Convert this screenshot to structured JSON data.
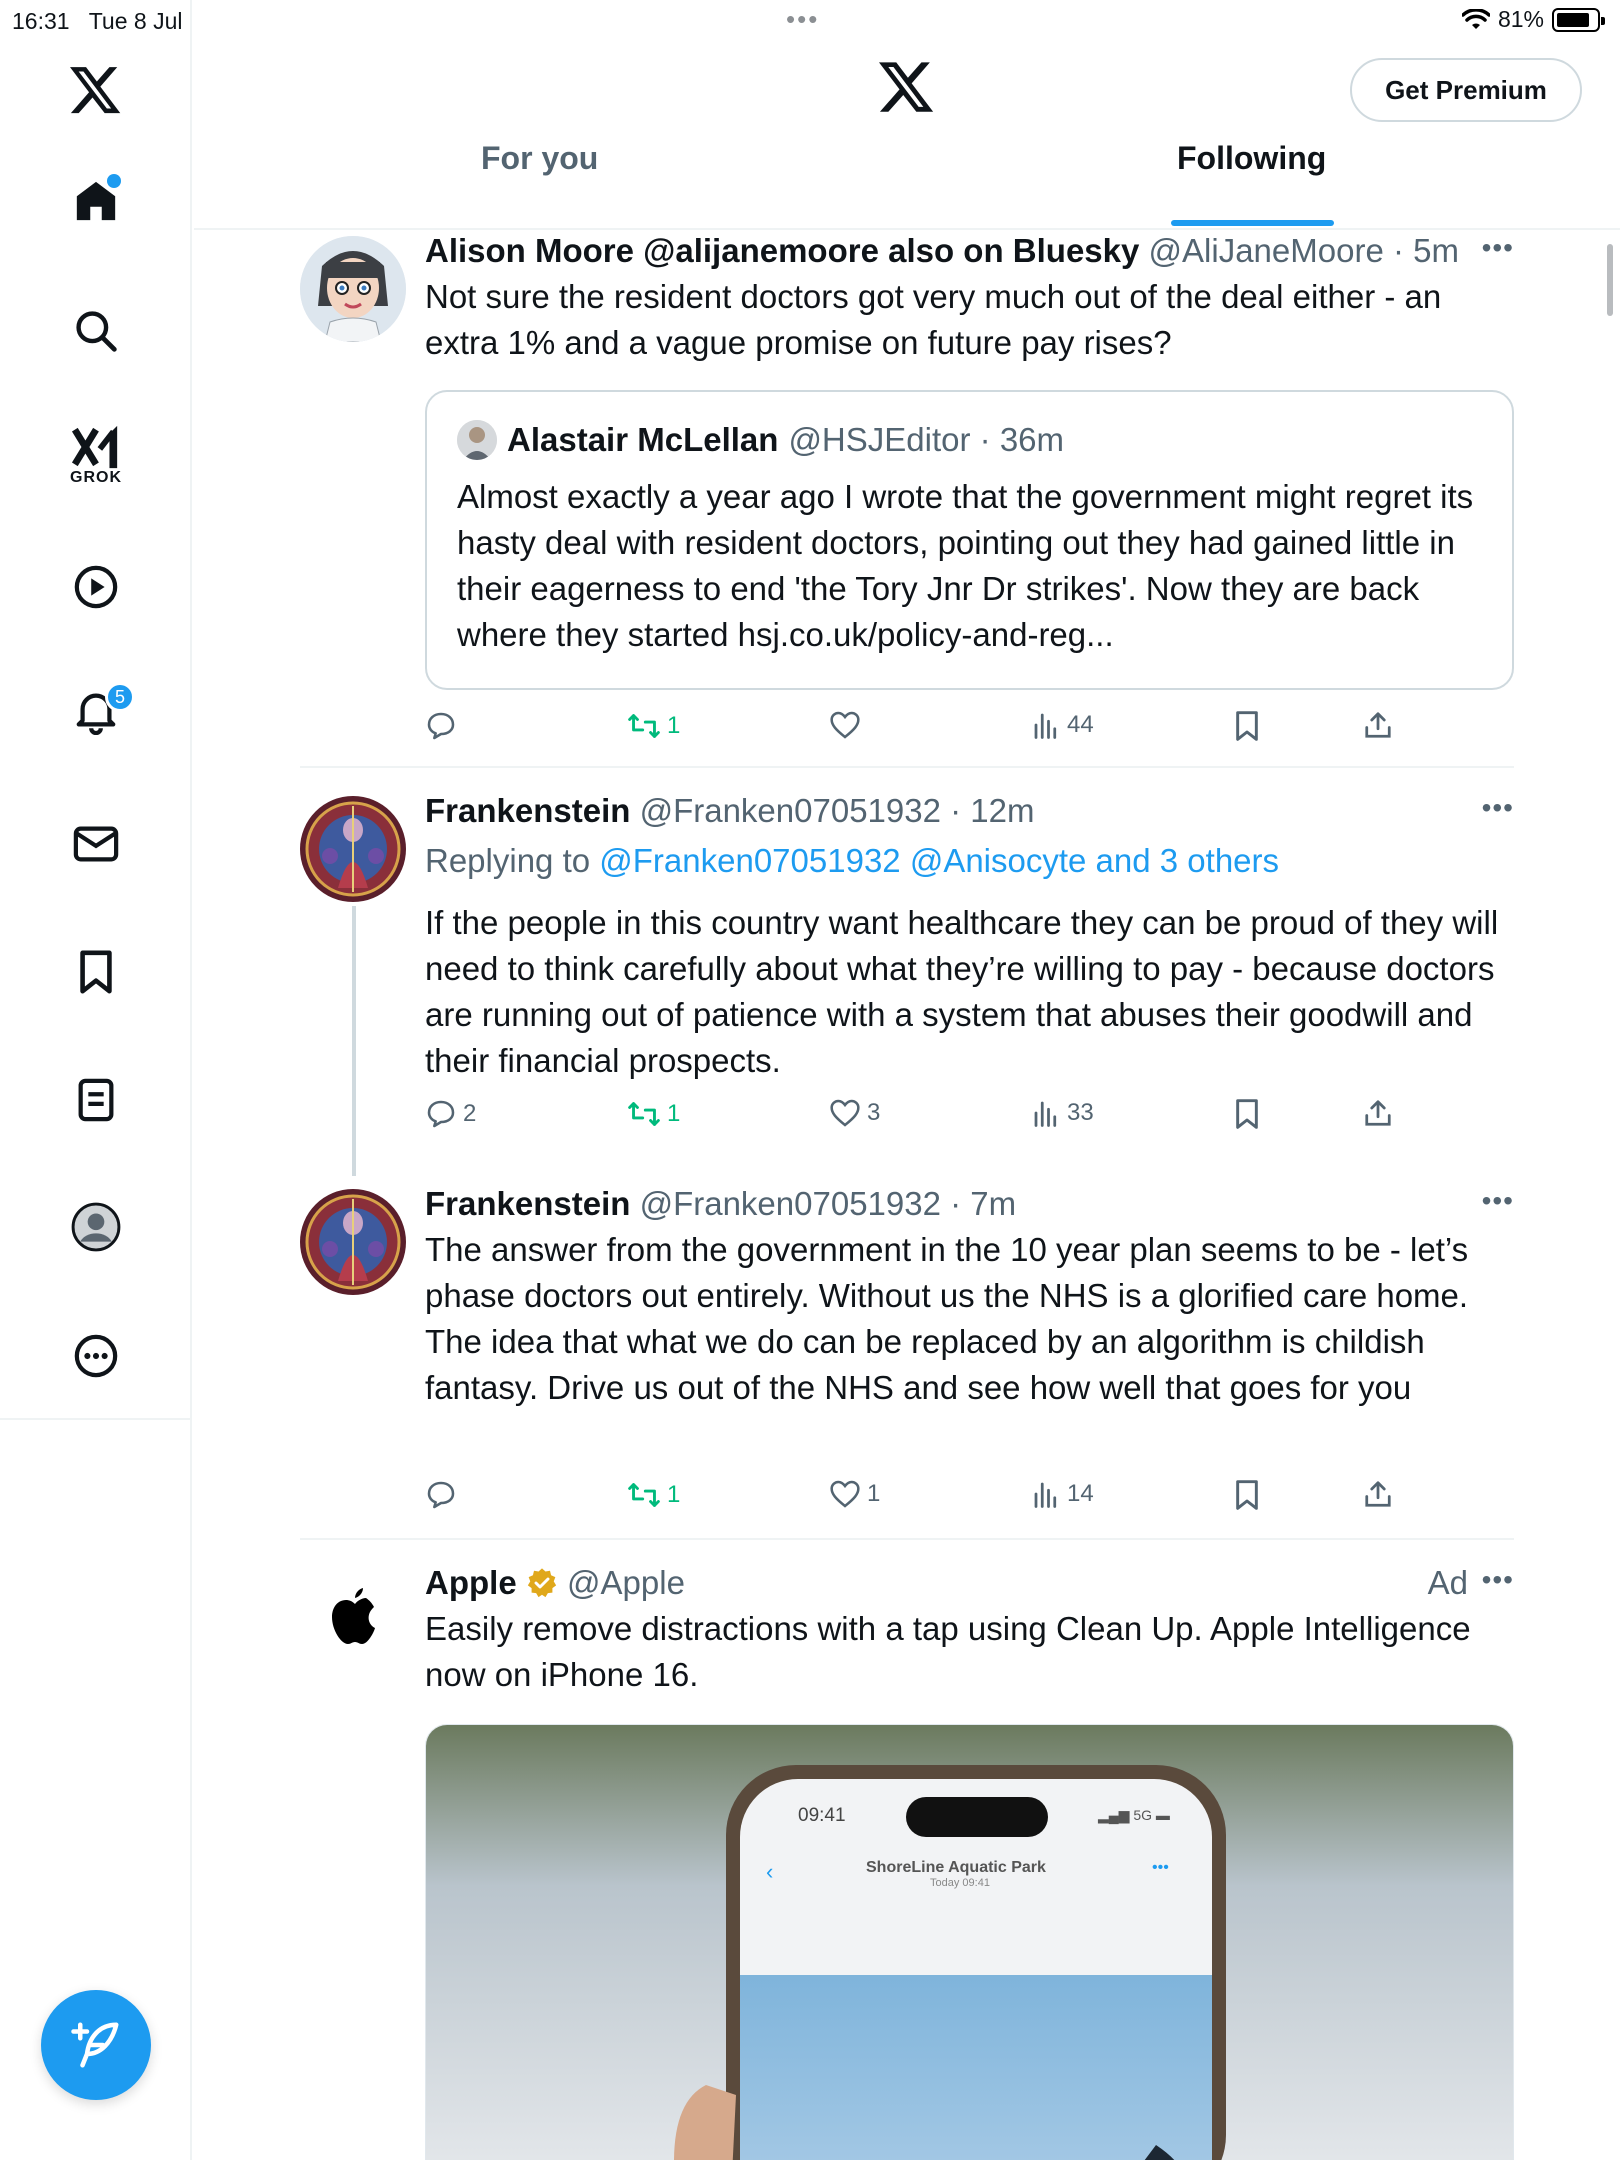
{
  "status_bar": {
    "time": "16:31",
    "date": "Tue 8 Jul",
    "battery": "81%"
  },
  "sidebar": {
    "grok_label": "GROK",
    "notifications_count": "5"
  },
  "header": {
    "premium_label": "Get Premium",
    "tabs": [
      {
        "label": "For you",
        "active": false
      },
      {
        "label": "Following",
        "active": true
      }
    ]
  },
  "tweets": [
    {
      "name": "Alison Moore @alijanemoore also on Bluesky",
      "handle": "@AliJaneMoore",
      "time": "5m",
      "text": "Not sure the resident doctors got very much out of the deal either - an extra 1% and a vague promise on future pay rises?",
      "quote": {
        "name": "Alastair McLellan",
        "handle": "@HSJEditor",
        "time": "36m",
        "text": "Almost exactly a year ago I wrote that the government might regret its hasty deal with resident doctors, pointing out they had gained little in their eagerness to end 'the Tory Jnr Dr strikes'. Now they are back where they started hsj.co.uk/policy-and-reg..."
      },
      "replies": "",
      "retweets": "1",
      "likes": "",
      "views": "44"
    },
    {
      "name": "Frankenstein",
      "handle": "@Franken07051932",
      "time": "12m",
      "replying_prefix": "Replying to ",
      "replying_to": "@Franken07051932 @Anisocyte and 3 others",
      "text": "If the people in this country want healthcare they can be proud of they will need to think carefully about what they’re willing to pay - because doctors are running out of patience with a system that abuses their goodwill and their financial prospects.",
      "replies": "2",
      "retweets": "1",
      "likes": "3",
      "views": "33"
    },
    {
      "name": "Frankenstein",
      "handle": "@Franken07051932",
      "time": "7m",
      "text": "The answer from the government in the 10 year plan seems to be - let’s phase doctors out entirely. Without us the NHS is a glorified care home. The idea that what we do can be replaced by an algorithm is childish fantasy. Drive us out of the NHS and see how well that goes for you",
      "replies": "",
      "retweets": "1",
      "likes": "1",
      "views": "14"
    },
    {
      "name": "Apple",
      "handle": "@Apple",
      "ad_label": "Ad",
      "text": "Easily remove distractions with a tap using Clean Up. Apple Intelligence now on iPhone 16.",
      "media": {
        "phone_time": "09:41",
        "phone_signal": "5G",
        "phone_title": "ShoreLine Aquatic Park",
        "phone_subtitle": "Today  09:41"
      }
    }
  ],
  "colors": {
    "accent": "#1d9bf0",
    "retweet": "#00ba7c",
    "secondary_text": "#536471",
    "border": "#cfd9de"
  }
}
